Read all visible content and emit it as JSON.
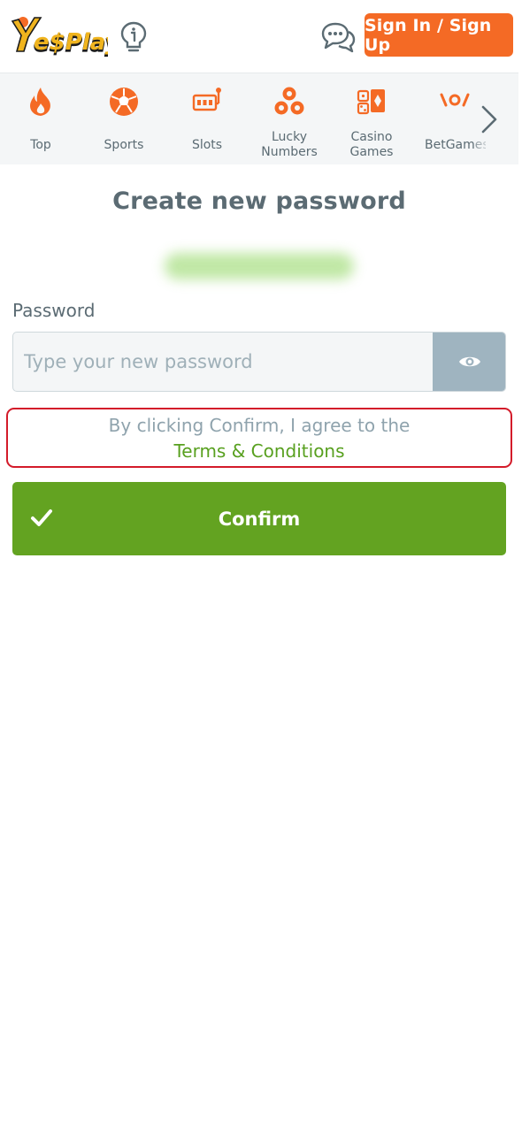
{
  "header": {
    "logo_text": "YesPlay",
    "signin_label": "Sign In / Sign Up"
  },
  "categories": [
    {
      "label": "Top",
      "icon": "fire-icon"
    },
    {
      "label": "Sports",
      "icon": "soccer-ball-icon"
    },
    {
      "label": "Slots",
      "icon": "slot-machine-icon"
    },
    {
      "label": "Lucky Numbers",
      "icon": "lottery-balls-icon"
    },
    {
      "label": "Casino Games",
      "icon": "dice-cards-icon"
    },
    {
      "label": "BetGames",
      "icon": "betgames-icon"
    }
  ],
  "main": {
    "title": "Create new password",
    "password_label": "Password",
    "password_placeholder": "Type your new password",
    "password_value": "",
    "terms_text": "By clicking Confirm, I agree to the",
    "terms_link": "Terms & Conditions",
    "confirm_label": "Confirm"
  },
  "colors": {
    "brand_orange": "#f46a25",
    "confirm_green": "#63a321",
    "highlight_red": "#d31b2a",
    "text_gray": "#5b6b73"
  }
}
